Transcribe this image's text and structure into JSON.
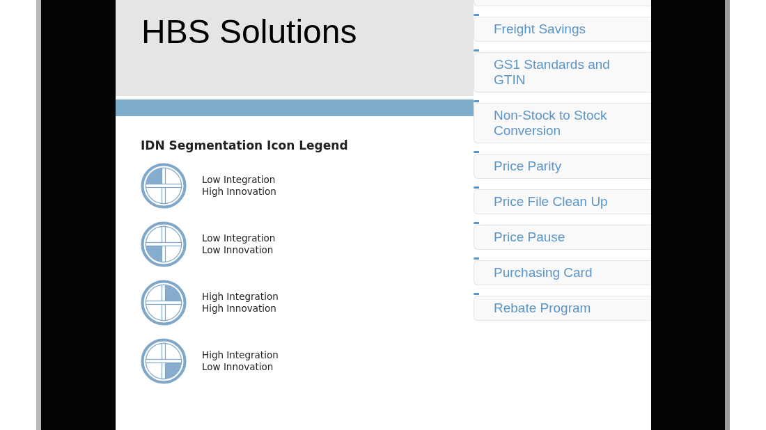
{
  "header": {
    "title": "HBS Solutions"
  },
  "legend": {
    "title": "IDN Segmentation Icon Legend",
    "items": [
      {
        "kind": "top-left",
        "lines": [
          "Low Integration",
          "High Innovation"
        ]
      },
      {
        "kind": "bottom-left",
        "lines": [
          "Low Integration",
          "Low Innovation"
        ]
      },
      {
        "kind": "top-right",
        "lines": [
          "High Integration",
          "High Innovation"
        ]
      },
      {
        "kind": "bottom-right",
        "lines": [
          "High Integration",
          "Low Innovation"
        ]
      }
    ]
  },
  "menu": {
    "items": [
      "Freight Savings",
      "GS1 Standards and GTIN",
      "Non-Stock to Stock Conversion",
      "Price Parity",
      "Price File Clean Up",
      "Price Pause",
      "Purchasing Card",
      "Rebate Program"
    ]
  }
}
